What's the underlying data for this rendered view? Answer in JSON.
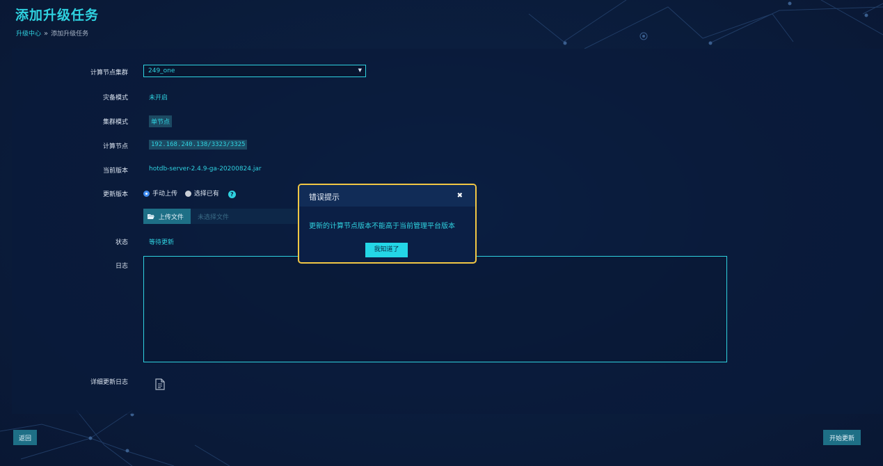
{
  "header": {
    "title": "添加升级任务",
    "breadcrumb": {
      "parent": "升级中心",
      "separator": "»",
      "current": "添加升级任务"
    }
  },
  "form": {
    "cluster": {
      "label": "计算节点集群",
      "value": "249_one"
    },
    "disaster_mode": {
      "label": "灾备模式",
      "value": "未开启"
    },
    "cluster_mode": {
      "label": "集群模式",
      "value": "单节点"
    },
    "compute_node": {
      "label": "计算节点",
      "value": "192.168.240.138/3323/3325"
    },
    "current_version": {
      "label": "当前版本",
      "value": "hotdb-server-2.4.9-ga-20200824.jar"
    },
    "update_version": {
      "label": "更新版本",
      "option_manual": "手动上传",
      "option_existing": "选择已有",
      "selected": "手动上传",
      "help_icon": "?"
    },
    "upload": {
      "button_label": "上传文件",
      "placeholder": "未选择文件"
    },
    "status": {
      "label": "状态",
      "value": "等待更新"
    },
    "log": {
      "label": "日志",
      "content": ""
    },
    "detail_log": {
      "label": "详细更新日志"
    }
  },
  "footer": {
    "back_label": "返回",
    "start_label": "开始更新"
  },
  "modal": {
    "title": "错误提示",
    "close_icon": "✖",
    "message": "更新的计算节点版本不能高于当前管理平台版本",
    "confirm_label": "我知道了"
  },
  "colors": {
    "accent": "#2fd2e0",
    "background": "#0b1e3e",
    "button": "#1e6f86",
    "modal_border": "#f2c744"
  },
  "icons": [
    "chevron-down-icon",
    "help-icon",
    "folder-icon",
    "document-icon",
    "close-icon"
  ]
}
